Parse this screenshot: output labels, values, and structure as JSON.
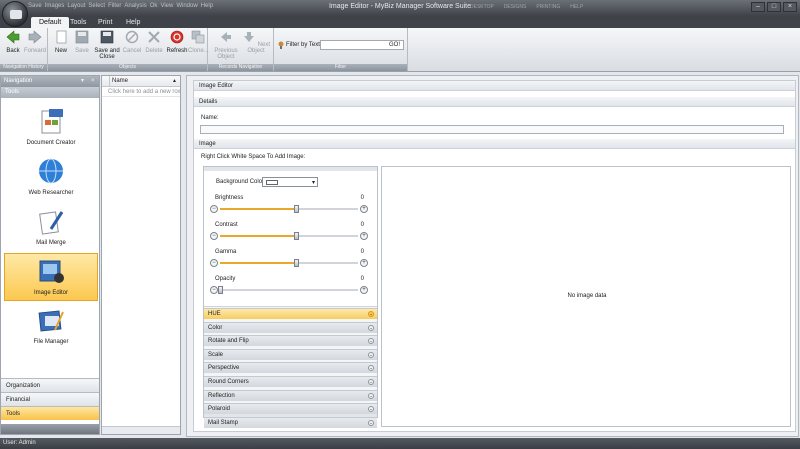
{
  "window": {
    "title": "Image Editor - MyBiz Manager Software Suite",
    "quick_access": [
      "Save",
      "Images",
      "Layout",
      "Select",
      "Filter",
      "Analysis",
      "Ok",
      "View",
      "Window",
      "Help"
    ],
    "menu_right": [
      "DESKTOP",
      "DESIGNS",
      "PRINTING",
      "HELP"
    ],
    "controls": {
      "minimize": "–",
      "maximize": "□",
      "close": "×"
    }
  },
  "tabs": [
    {
      "label": "Default",
      "active": true
    },
    {
      "label": "Tools"
    },
    {
      "label": "Print"
    },
    {
      "label": "Help"
    }
  ],
  "ribbon": {
    "nav_history": {
      "label": "Navigation History",
      "back": "Back",
      "forward": "Forward"
    },
    "objects": {
      "label": "Objects",
      "new": "New",
      "save": "Save",
      "save_close": "Save and Close",
      "cancel": "Cancel",
      "delete": "Delete",
      "refresh": "Refresh",
      "clone": "Clone..."
    },
    "records_navigation": {
      "label": "Records Navigation",
      "previous": "Previous Object",
      "next": "Next Object"
    },
    "filter": {
      "label": "Filter",
      "filter_by_text": "Filter by Text",
      "go": "GO!"
    }
  },
  "navigation": {
    "header": "Navigation",
    "pin": "▾",
    "close": "×",
    "section": "Tools",
    "items": [
      {
        "label": "Document Creator",
        "icon": "document-creator-icon"
      },
      {
        "label": "Web Researcher",
        "icon": "globe-icon"
      },
      {
        "label": "Mail Merge",
        "icon": "mail-merge-icon"
      },
      {
        "label": "Image Editor",
        "icon": "image-editor-icon",
        "active": true
      },
      {
        "label": "File Manager",
        "icon": "file-manager-icon"
      }
    ],
    "bottom_groups": [
      {
        "label": "Organization"
      },
      {
        "label": "Financial"
      },
      {
        "label": "Tools",
        "active": true
      }
    ]
  },
  "list": {
    "column": "Name",
    "sort": "▲",
    "hint": "Click here to add a new row"
  },
  "editor": {
    "title": "Image Editor",
    "details_header": "Details",
    "name_label": "Name:",
    "name_value": "",
    "image_header": "Image",
    "right_click_hint": "Right Click White Space To Add Image:",
    "background_color_label": "Background Color",
    "background_color": "#ffffff",
    "sliders": [
      {
        "label": "Brightness",
        "value": 0,
        "fraction": 0.55,
        "filled": true
      },
      {
        "label": "Contrast",
        "value": 0,
        "fraction": 0.55,
        "filled": true
      },
      {
        "label": "Gamma",
        "value": 0,
        "fraction": 0.55,
        "filled": true
      },
      {
        "label": "Opacity",
        "value": 0,
        "fraction": 0.0,
        "filled": false
      }
    ],
    "sections": [
      {
        "label": "HUE",
        "active": true
      },
      {
        "label": "Color"
      },
      {
        "label": "Rotate and Flip"
      },
      {
        "label": "Scale"
      },
      {
        "label": "Perspective"
      },
      {
        "label": "Round Corners"
      },
      {
        "label": "Reflection"
      },
      {
        "label": "Polaroid"
      },
      {
        "label": "Mail Stamp"
      }
    ],
    "no_image": "No image data"
  },
  "status": {
    "user": "User: Admin"
  },
  "colors": {
    "accent": "#f7c14a",
    "fill": "#e9a82b"
  }
}
